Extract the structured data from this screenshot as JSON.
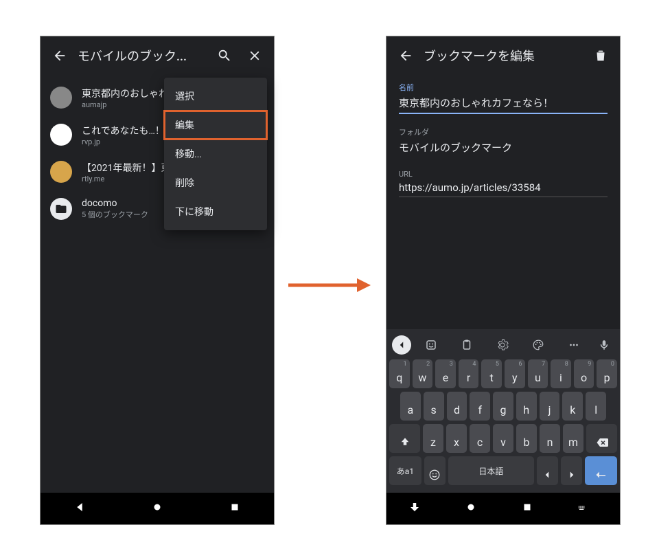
{
  "left": {
    "title": "モバイルのブック...",
    "bookmarks": [
      {
        "title": "東京都内のおしゃれ...",
        "sub": "aumajp"
      },
      {
        "title": "これであなたも…！",
        "sub": "rvp.jp"
      },
      {
        "title": "【2021年最新！】東",
        "sub": "rtly.me"
      },
      {
        "title": "docomo",
        "sub": "5 個のブックマーク",
        "folder": true
      }
    ],
    "popup": [
      {
        "label": "選択"
      },
      {
        "label": "編集",
        "hl": true
      },
      {
        "label": "移動..."
      },
      {
        "label": "削除"
      },
      {
        "label": "下に移動"
      }
    ]
  },
  "right": {
    "title": "ブックマークを編集",
    "fields": {
      "name_label": "名前",
      "name_value": "東京都内のおしゃれカフェなら！",
      "folder_label": "フォルダ",
      "folder_value": "モバイルのブックマーク",
      "url_label": "URL",
      "url_value": "https://aumo.jp/articles/33584"
    },
    "keyboard": {
      "row1": [
        "q",
        "w",
        "e",
        "r",
        "t",
        "y",
        "u",
        "i",
        "o",
        "p"
      ],
      "hints1": [
        "1",
        "2",
        "3",
        "4",
        "5",
        "6",
        "7",
        "8",
        "9",
        "0"
      ],
      "row2": [
        "a",
        "s",
        "d",
        "f",
        "g",
        "h",
        "j",
        "k",
        "l"
      ],
      "row3": [
        "z",
        "x",
        "c",
        "v",
        "b",
        "n",
        "m"
      ],
      "mode_key": "あa1",
      "lang_key": "日本語"
    }
  }
}
